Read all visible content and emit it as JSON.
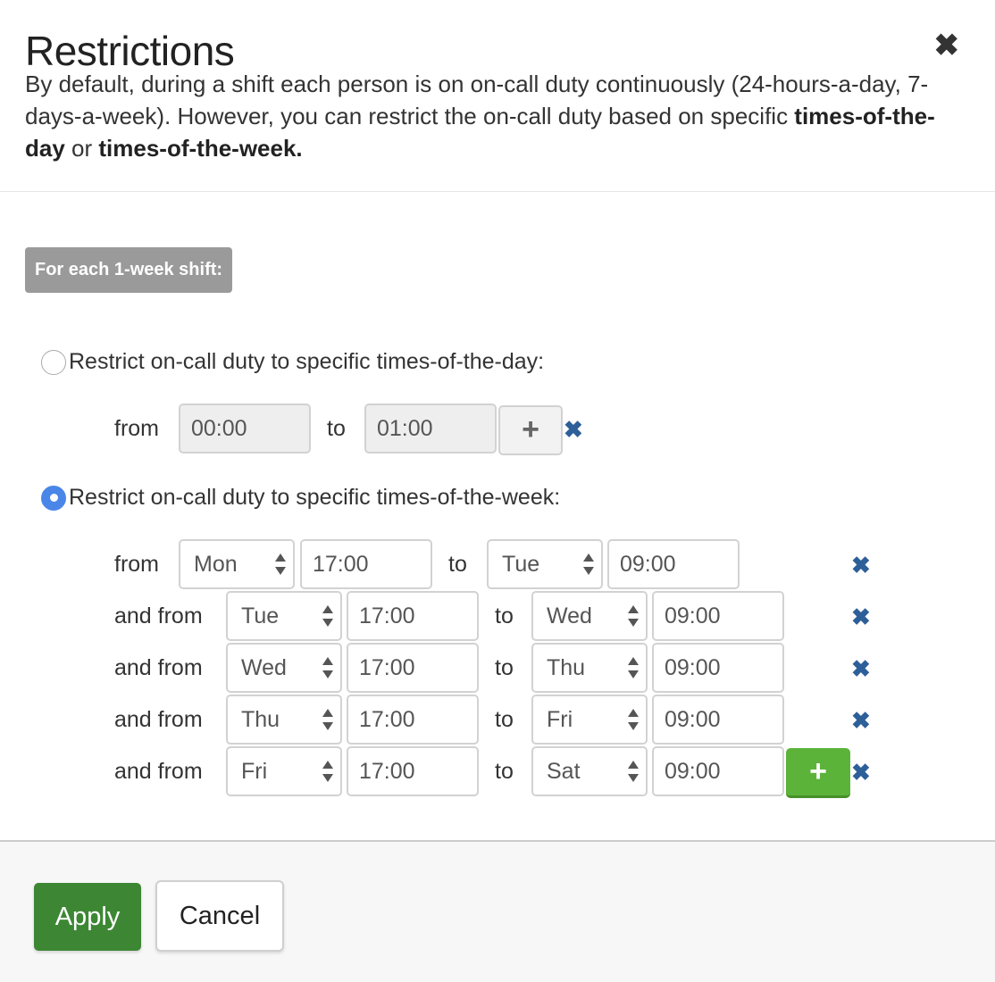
{
  "dialog": {
    "title": "Restrictions",
    "close_icon": "close-icon",
    "description_part1": "By default, during a shift each person is on on-call duty continuously (24-hours-a-day, 7-days-a-week). However, you can restrict the on-call duty based on specific ",
    "description_bold1": "times-of-the-day",
    "description_or": " or ",
    "description_bold2": "times-of-the-week."
  },
  "shift_badge": "For each 1-week shift:",
  "day_option": {
    "label": "Restrict on-call duty to specific times-of-the-day:",
    "selected": false,
    "from_label": "from",
    "to_label": "to",
    "from_value": "00:00",
    "to_value": "01:00",
    "add_icon": "plus-icon",
    "remove_icon": "remove-icon"
  },
  "week_option": {
    "label": "Restrict on-call duty to specific times-of-the-week:",
    "selected": true,
    "to_label": "to",
    "rows": [
      {
        "prefix": "from",
        "from_day": "Mon",
        "from_time": "17:00",
        "to_day": "Tue",
        "to_time": "09:00"
      },
      {
        "prefix": "and from",
        "from_day": "Tue",
        "from_time": "17:00",
        "to_day": "Wed",
        "to_time": "09:00"
      },
      {
        "prefix": "and from",
        "from_day": "Wed",
        "from_time": "17:00",
        "to_day": "Thu",
        "to_time": "09:00"
      },
      {
        "prefix": "and from",
        "from_day": "Thu",
        "from_time": "17:00",
        "to_day": "Fri",
        "to_time": "09:00"
      },
      {
        "prefix": "and from",
        "from_day": "Fri",
        "from_time": "17:00",
        "to_day": "Sat",
        "to_time": "09:00"
      }
    ],
    "add_symbol": "+",
    "remove_symbol": "✖"
  },
  "footer": {
    "apply_label": "Apply",
    "cancel_label": "Cancel"
  },
  "colors": {
    "apply": "#3d8734",
    "add_green": "#5cb33a",
    "remove_blue": "#2d5f99",
    "radio_selected": "#4a86e8"
  }
}
